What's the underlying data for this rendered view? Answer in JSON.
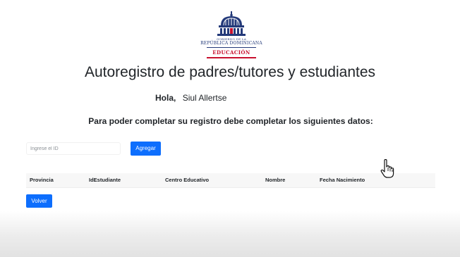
{
  "logo": {
    "government_text": "GOBIERNO DE LA",
    "country_text": "REPÚBLICA DOMINICANA",
    "department_text": "EDUCACIÓN",
    "colors": {
      "blue": "#243a7a",
      "red": "#c8102e"
    }
  },
  "header": {
    "title": "Autoregistro de padres/tutores y estudiantes"
  },
  "greeting": {
    "label": "Hola,",
    "user_name": "Siul Allertse"
  },
  "instructions": "Para poder completar su registro debe completar los siguientes datos:",
  "search": {
    "placeholder": "Ingrese el ID",
    "value": "",
    "add_button_label": "Agregar"
  },
  "table": {
    "columns": [
      "Provincia",
      "IdEstudiante",
      "Centro Educativo",
      "Nombre",
      "Fecha Nacimiento"
    ],
    "rows": []
  },
  "actions": {
    "back_button_label": "Volver"
  },
  "colors": {
    "primary": "#0d6efd",
    "text": "#212529",
    "table_header_bg": "#f7f7f7"
  },
  "icons": {
    "cursor": "hand-pointer-icon"
  }
}
